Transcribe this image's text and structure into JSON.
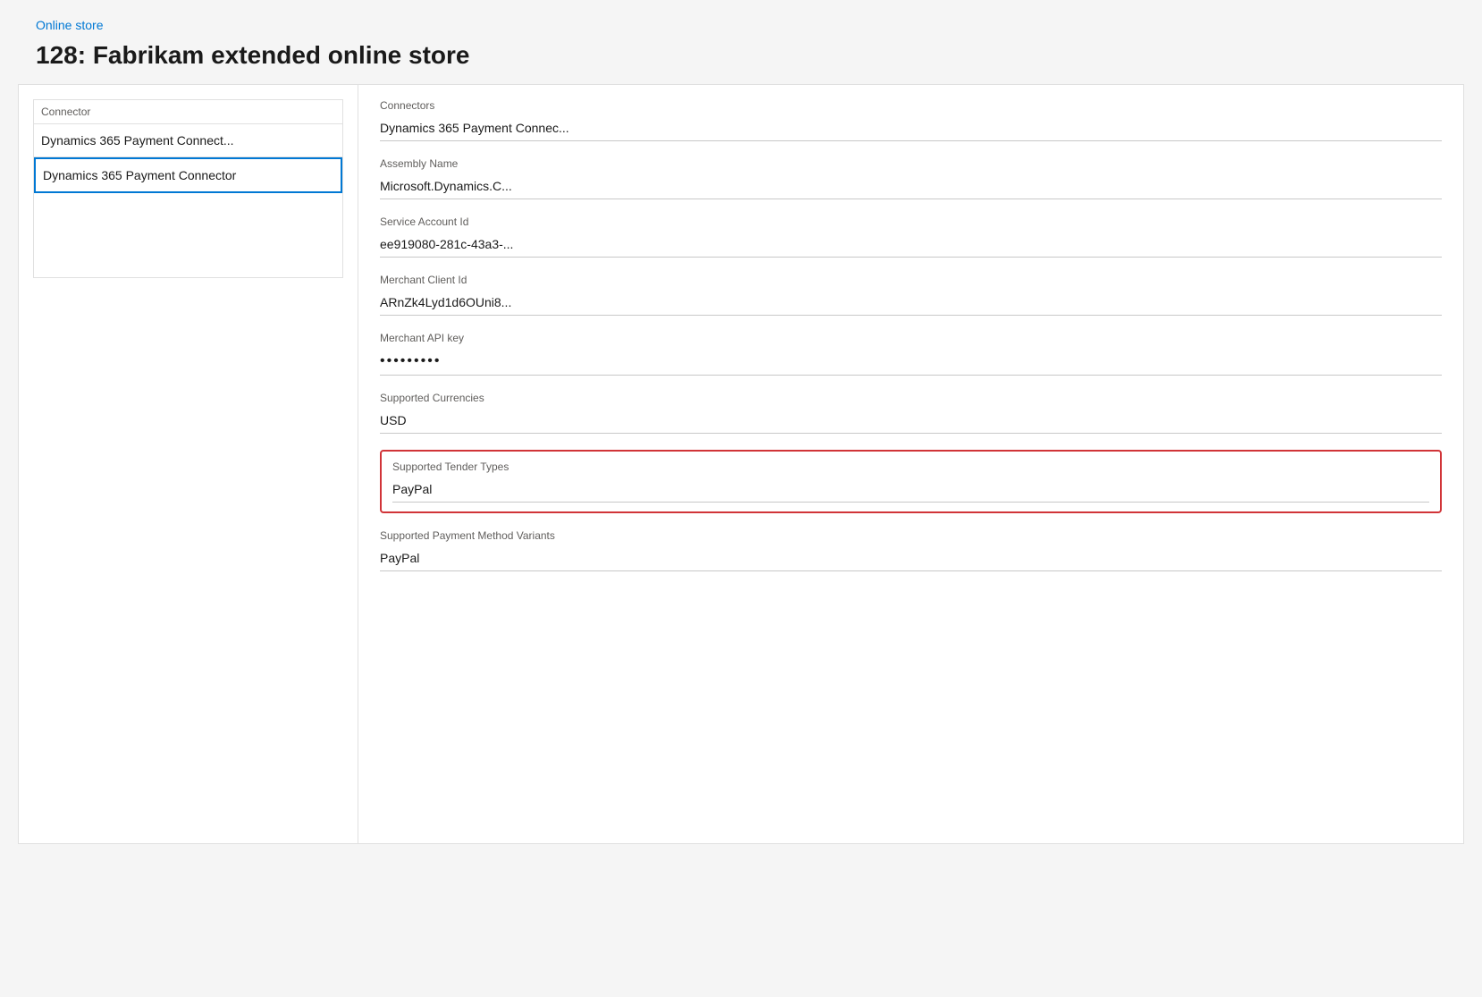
{
  "breadcrumb": {
    "label": "Online store",
    "link": "#"
  },
  "page": {
    "title": "128: Fabrikam extended online store"
  },
  "left_panel": {
    "section_label": "Connector",
    "items": [
      {
        "text": "Dynamics 365 Payment Connect...",
        "selected": false
      },
      {
        "text": "Dynamics 365 Payment Connector",
        "selected": true
      }
    ]
  },
  "right_panel": {
    "fields": [
      {
        "label": "Connectors",
        "value": "Dynamics 365 Payment Connec...",
        "id": "connectors",
        "highlighted": false,
        "is_password": false
      },
      {
        "label": "Assembly Name",
        "value": "Microsoft.Dynamics.C...",
        "id": "assembly-name",
        "highlighted": false,
        "is_password": false
      },
      {
        "label": "Service Account Id",
        "value": "ee919080-281c-43a3-...",
        "id": "service-account-id",
        "highlighted": false,
        "is_password": false
      },
      {
        "label": "Merchant Client Id",
        "value": "ARnZk4Lyd1d6OUni8...",
        "id": "merchant-client-id",
        "highlighted": false,
        "is_password": false
      },
      {
        "label": "Merchant API key",
        "value": "•••••••••",
        "id": "merchant-api-key",
        "highlighted": false,
        "is_password": true
      },
      {
        "label": "Supported Currencies",
        "value": "USD",
        "id": "supported-currencies",
        "highlighted": false,
        "is_password": false
      },
      {
        "label": "Supported Tender Types",
        "value": "PayPal",
        "id": "supported-tender-types",
        "highlighted": true,
        "is_password": false
      },
      {
        "label": "Supported Payment Method Variants",
        "value": "PayPal",
        "id": "supported-payment-method-variants",
        "highlighted": false,
        "is_password": false
      }
    ]
  }
}
